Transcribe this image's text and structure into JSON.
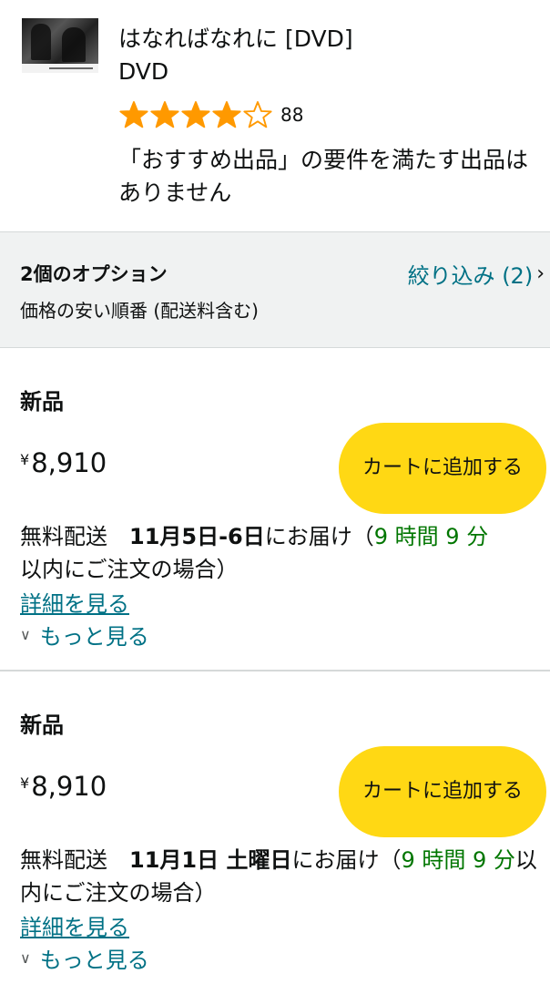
{
  "product": {
    "title": "はなればなれに [DVD]",
    "format": "DVD",
    "rating_stars": 4,
    "rating_max": 5,
    "review_count": "88",
    "notice": "「おすすめ出品」の要件を満たす出品はありません"
  },
  "options": {
    "heading": "2個のオプション",
    "sort": "価格の安い順番 (配送料含む)",
    "filter_label": "絞り込み (2)"
  },
  "offers": [
    {
      "condition": "新品",
      "currency": "¥",
      "price": "8,910",
      "cart_label": "カートに追加する",
      "delivery_prefix": "無料配送　",
      "delivery_date": "11月5日-6日",
      "delivery_mid": "にお届け（",
      "delivery_time": "9 時間 9 分",
      "delivery_suffix": "以内にご注文の場合）",
      "details_label": "詳細を見る",
      "more_label": "もっと見る"
    },
    {
      "condition": "新品",
      "currency": "¥",
      "price": "8,910",
      "cart_label": "カートに追加する",
      "delivery_prefix": "無料配送　",
      "delivery_date": "11月1日 土曜日",
      "delivery_mid": "にお届け（",
      "delivery_time": "9 時間 9 分",
      "delivery_suffix": "以内にご注文の場合）",
      "details_label": "詳細を見る",
      "more_label": "もっと見る"
    }
  ],
  "colors": {
    "star": "#ff9900",
    "link": "#007185",
    "cart_button": "#ffd814",
    "delivery_time": "#007600",
    "options_bg": "#f0f2f2"
  },
  "icons": [
    "star-filled-icon",
    "star-empty-icon",
    "chevron-right-icon",
    "chevron-down-icon"
  ]
}
